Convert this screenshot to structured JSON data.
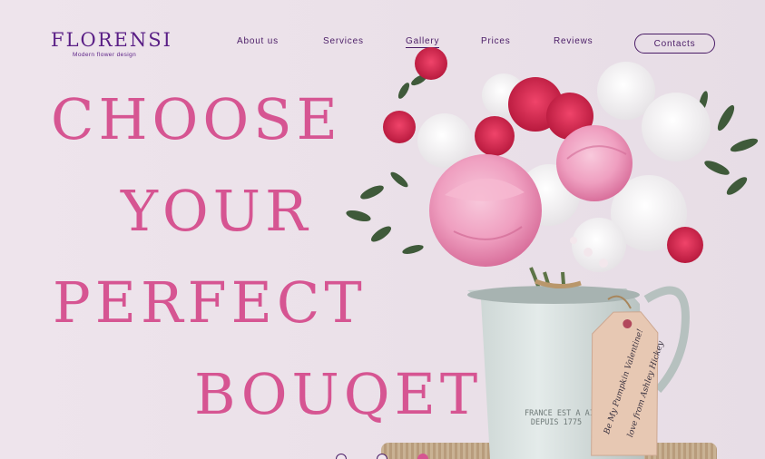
{
  "brand": {
    "name": "FLORENSI",
    "tagline": "Modern flower design"
  },
  "nav": {
    "items": [
      {
        "label": "About us",
        "active": false
      },
      {
        "label": "Services",
        "active": false
      },
      {
        "label": "Gallery",
        "active": true
      },
      {
        "label": "Prices",
        "active": false
      },
      {
        "label": "Reviews",
        "active": false
      }
    ],
    "contacts_label": "Contacts"
  },
  "hero": {
    "lines": [
      "CHOOSE",
      "YOUR",
      "PERFECT",
      "BOUQET"
    ]
  },
  "jug": {
    "stamp_line1": "FRANCE EST A AIX",
    "stamp_line2": "DEPUIS 1775"
  },
  "tag": {
    "line1": "Be My Pumpkin Valentine!",
    "line2": "love from Ashley Hickey"
  },
  "slider": {
    "dot_count": 3,
    "active_index": 2
  },
  "colors": {
    "accent": "#d65592",
    "brand": "#5a1f86",
    "nav_text": "#4a1c66",
    "background": "#ece2ea"
  }
}
